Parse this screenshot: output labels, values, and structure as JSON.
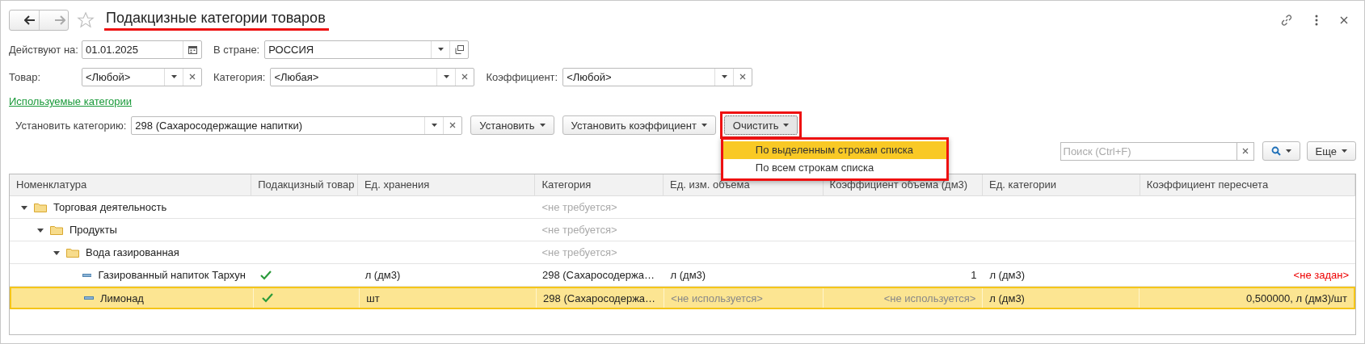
{
  "window": {
    "title": "Подакцизные категории товаров",
    "favorite": false
  },
  "filter_rows": [
    [
      {
        "label": "Действуют на:",
        "value": "01.01.2025",
        "kind": "date"
      },
      {
        "label": "В стране:",
        "value": "РОССИЯ",
        "kind": "open"
      }
    ],
    [
      {
        "label": "Товар:",
        "value": "<Любой>",
        "kind": "clear"
      },
      {
        "label": "Категория:",
        "value": "<Любая>",
        "kind": "clear"
      },
      {
        "label": "Коэффициент:",
        "value": "<Любой>",
        "kind": "clear"
      }
    ]
  ],
  "link": "Используемые категории",
  "set_category": {
    "label": "Установить категорию:",
    "value": "298 (Сахаросодержащие напитки)"
  },
  "buttons": [
    {
      "label": "Установить",
      "menu_open": false
    },
    {
      "label": "Установить коэффициент",
      "menu_open": false
    },
    {
      "label": "Очистить",
      "menu_open": true
    }
  ],
  "menu": [
    {
      "label": "По выделенным строкам списка",
      "selected": true
    },
    {
      "label": "По всем строкам списка",
      "selected": false
    }
  ],
  "search": {
    "placeholder": "Поиск (Ctrl+F)"
  },
  "more_button": "Еще",
  "table": {
    "columns": [
      "Номенклатура",
      "Подакцизный товар",
      "Ед. хранения",
      "Категория",
      "Ед. изм. объема",
      "Коэффициент объема (дм3)",
      "Ед. категории",
      "Коэффициент пересчета"
    ],
    "rows": [
      {
        "kind": "folder",
        "expanded": true,
        "selected": false,
        "cells": [
          {
            "text": "Торговая деятельность",
            "muted": false,
            "error": false
          },
          "",
          "",
          {
            "text": "<не требуется>",
            "muted": true,
            "error": false
          },
          "",
          "",
          "",
          ""
        ],
        "children": [
          {
            "kind": "folder",
            "expanded": true,
            "selected": false,
            "cells": [
              {
                "text": "Продукты",
                "muted": false,
                "error": false
              },
              "",
              "",
              {
                "text": "<не требуется>",
                "muted": true,
                "error": false
              },
              "",
              "",
              "",
              ""
            ],
            "children": [
              {
                "kind": "folder",
                "expanded": true,
                "selected": false,
                "cells": [
                  {
                    "text": "Вода газированная",
                    "muted": false,
                    "error": false
                  },
                  "",
                  "",
                  {
                    "text": "<не требуется>",
                    "muted": true,
                    "error": false
                  },
                  "",
                  "",
                  "",
                  ""
                ],
                "children": [
                  {
                    "kind": "item",
                    "excisable": true,
                    "selected": false,
                    "cells": [
                      {
                        "text": "Газированный напиток Тархун",
                        "muted": false,
                        "error": false
                      },
                      "",
                      {
                        "text": "л (дм3)",
                        "muted": false,
                        "error": false
                      },
                      {
                        "text": "298 (Сахаросодержа…",
                        "muted": false,
                        "error": false
                      },
                      {
                        "text": "л (дм3)",
                        "muted": false,
                        "error": false
                      },
                      {
                        "text": "1",
                        "muted": false,
                        "error": false
                      },
                      {
                        "text": "л (дм3)",
                        "muted": false,
                        "error": false
                      },
                      {
                        "text": "<не задан>",
                        "muted": false,
                        "error": true
                      }
                    ]
                  },
                  {
                    "kind": "item",
                    "excisable": true,
                    "selected": true,
                    "cells": [
                      {
                        "text": "Лимонад",
                        "muted": false,
                        "error": false
                      },
                      "",
                      {
                        "text": "шт",
                        "muted": false,
                        "error": false
                      },
                      {
                        "text": "298 (Сахаросодержа…",
                        "muted": false,
                        "error": false
                      },
                      {
                        "text": "<не используется>",
                        "muted": true,
                        "error": false
                      },
                      {
                        "text": "<не используется>",
                        "muted": true,
                        "error": false
                      },
                      {
                        "text": "л (дм3)",
                        "muted": false,
                        "error": false
                      },
                      {
                        "text": "0,500000, л (дм3)/шт",
                        "muted": false,
                        "error": false
                      }
                    ]
                  }
                ]
              }
            ]
          }
        ]
      }
    ]
  }
}
